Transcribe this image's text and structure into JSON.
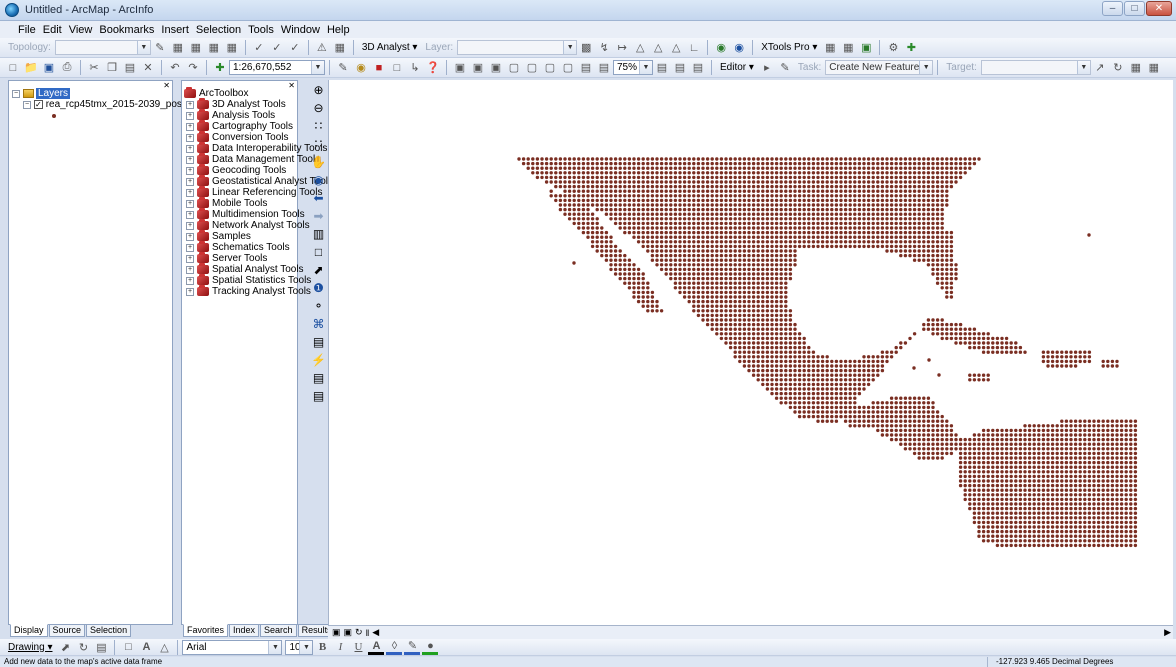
{
  "window": {
    "title": "Untitled - ArcMap - ArcInfo"
  },
  "menu": [
    "File",
    "Edit",
    "View",
    "Bookmarks",
    "Insert",
    "Selection",
    "Tools",
    "Window",
    "Help"
  ],
  "toolbar1": {
    "topology_label": "Topology:",
    "analyst_label": "3D Analyst ▾",
    "layer_label": "Layer:",
    "xtools_label": "XTools Pro ▾"
  },
  "toolbar2": {
    "scale_value": "1:26,670,552",
    "editor_label": "Editor ▾",
    "task_label": "Task:",
    "task_value": "Create New Feature",
    "target_label": "Target:",
    "zoom_value": "75%"
  },
  "toc": {
    "root": "Layers",
    "layer_name": "rea_rcp45tmx_2015-2039_pos",
    "tabs": [
      "Display",
      "Source",
      "Selection"
    ]
  },
  "toolbox": {
    "root": "ArcToolbox",
    "items": [
      "3D Analyst Tools",
      "Analysis Tools",
      "Cartography Tools",
      "Conversion Tools",
      "Data Interoperability Tools",
      "Data Management Tools",
      "Geocoding Tools",
      "Geostatistical Analyst Tools",
      "Linear Referencing Tools",
      "Mobile Tools",
      "Multidimension Tools",
      "Network Analyst Tools",
      "Samples",
      "Schematics Tools",
      "Server Tools",
      "Spatial Analyst Tools",
      "Spatial Statistics Tools",
      "Tracking Analyst Tools"
    ],
    "tabs": [
      "Favorites",
      "Index",
      "Search",
      "Results"
    ]
  },
  "drawing": {
    "drawing_label": "Drawing ▾",
    "font_value": "Arial",
    "size_value": "10"
  },
  "status": {
    "message": "Add new data to the map's active data frame",
    "coords": "-127.923  9.465 Decimal Degrees"
  },
  "colors": {
    "point": "#7a2e22",
    "map_bg": "#ffffff",
    "selected": "#316ac5"
  }
}
